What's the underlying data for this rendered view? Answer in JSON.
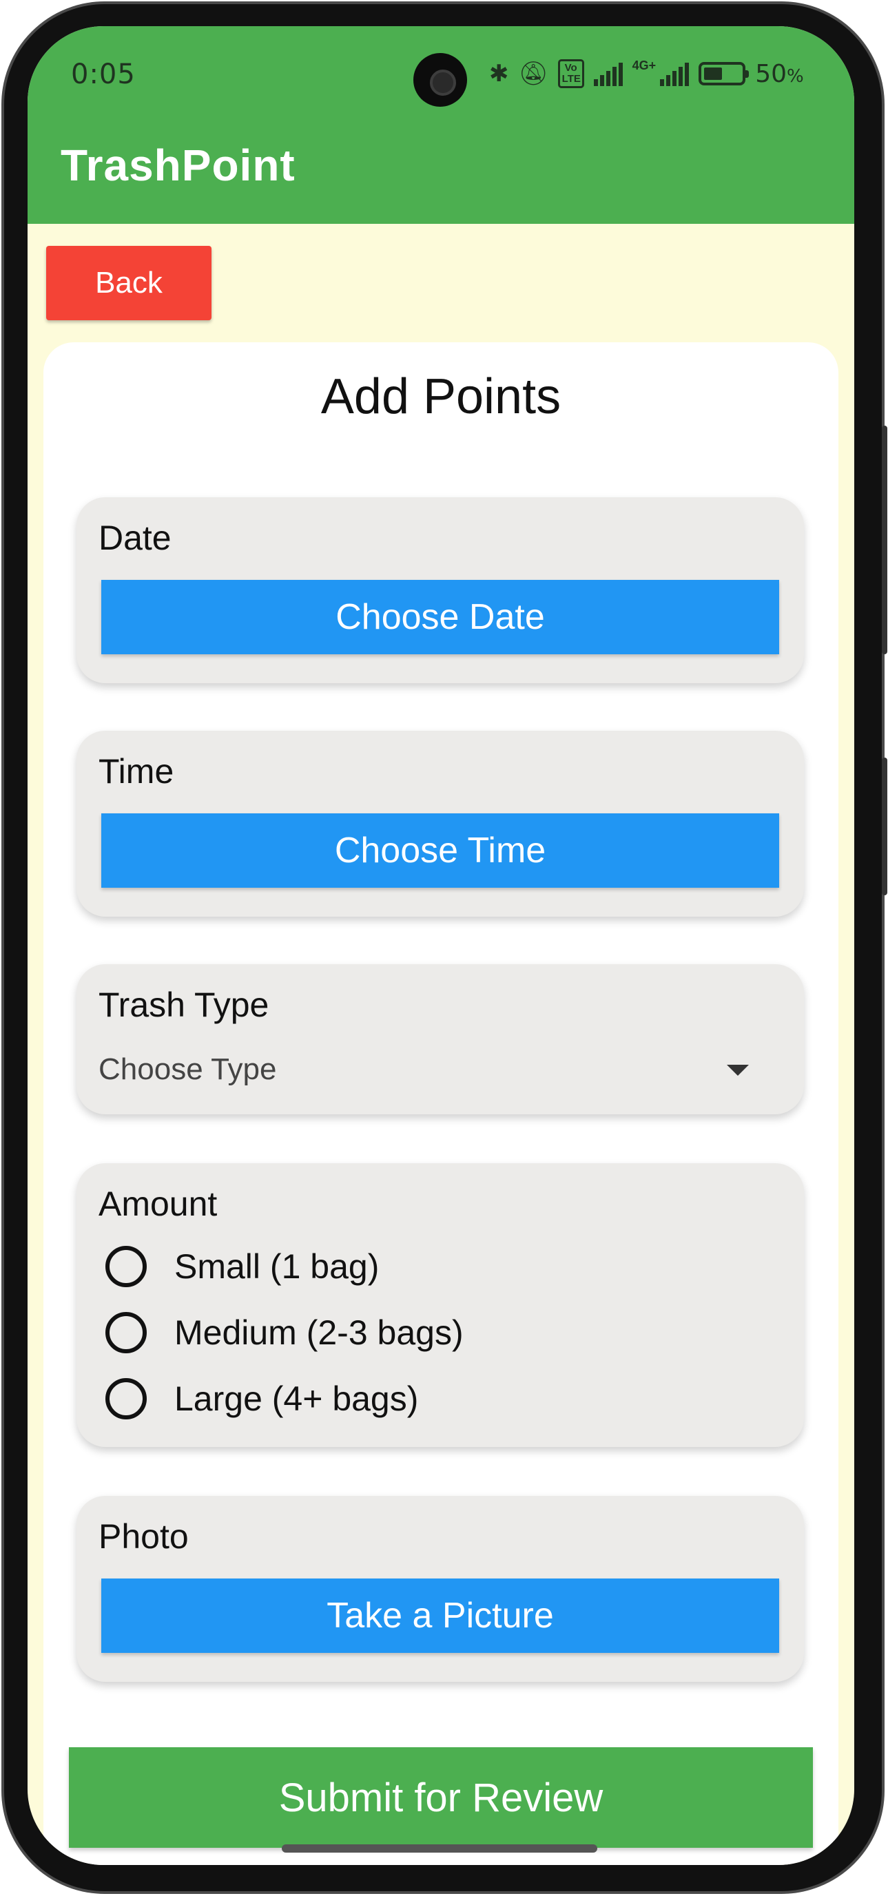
{
  "status_bar": {
    "time": "0:05",
    "network": "4G+",
    "volte": "Vo LTE",
    "battery_percent": "50",
    "battery_unit": "%",
    "battery_level": 0.5,
    "icons": [
      "bluetooth-icon",
      "silent-icon",
      "volte-icon",
      "signal-icon",
      "signal-4g-icon",
      "battery-icon"
    ]
  },
  "app_bar": {
    "title": "TrashPoint",
    "color": "#4caf50"
  },
  "back_button": {
    "label": "Back",
    "color": "#f44336"
  },
  "form": {
    "title": "Add Points",
    "date": {
      "label": "Date",
      "button": "Choose Date"
    },
    "time": {
      "label": "Time",
      "button": "Choose Time"
    },
    "trash_type": {
      "label": "Trash Type",
      "selected": "Choose Type"
    },
    "amount": {
      "label": "Amount",
      "options": [
        "Small (1 bag)",
        "Medium (2-3 bags)",
        "Large (4+ bags)"
      ]
    },
    "photo": {
      "label": "Photo",
      "button": "Take a Picture"
    },
    "submit": "Submit for Review"
  },
  "colors": {
    "background": "#fdfbda",
    "primary_button": "#2196f3",
    "section_bg": "#ecebe9"
  }
}
